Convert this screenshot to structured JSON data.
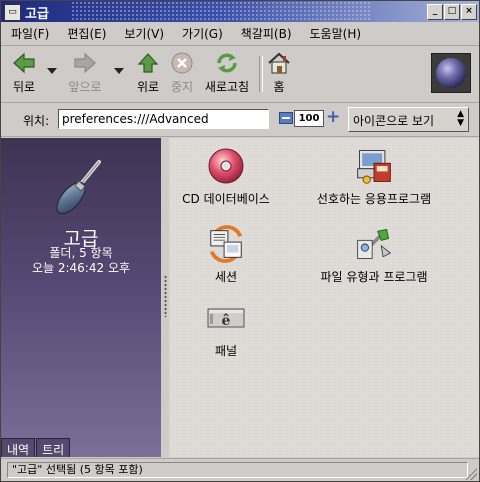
{
  "window": {
    "title": "고급"
  },
  "menubar": [
    "파일(F)",
    "편집(E)",
    "보기(V)",
    "가기(G)",
    "책갈피(B)",
    "도움말(H)"
  ],
  "toolbar": {
    "back": "뒤로",
    "forward": "앞으로",
    "up": "위로",
    "stop": "중지",
    "reload": "새로고침",
    "home": "홈"
  },
  "location": {
    "label": "위치:",
    "value": "preferences:///Advanced",
    "zoom": "100",
    "view_mode": "아이콘으로 보기"
  },
  "sidebar": {
    "title": "고급",
    "info_line1": "폴더, 5 항목",
    "info_line2": "오늘 2:46:42 오후",
    "tabs": [
      "내역",
      "트리"
    ]
  },
  "items": [
    {
      "label": "CD 데이터베이스",
      "icon": "cd-database-icon"
    },
    {
      "label": "선호하는 응용프로그램",
      "icon": "preferred-apps-icon"
    },
    {
      "label": "세션",
      "icon": "session-icon"
    },
    {
      "label": "파일 유형과 프로그램",
      "icon": "file-types-icon"
    },
    {
      "label": "패널",
      "icon": "panel-icon"
    }
  ],
  "status": {
    "text": "\"고급\" 선택됨 (5 항목 포함)"
  }
}
